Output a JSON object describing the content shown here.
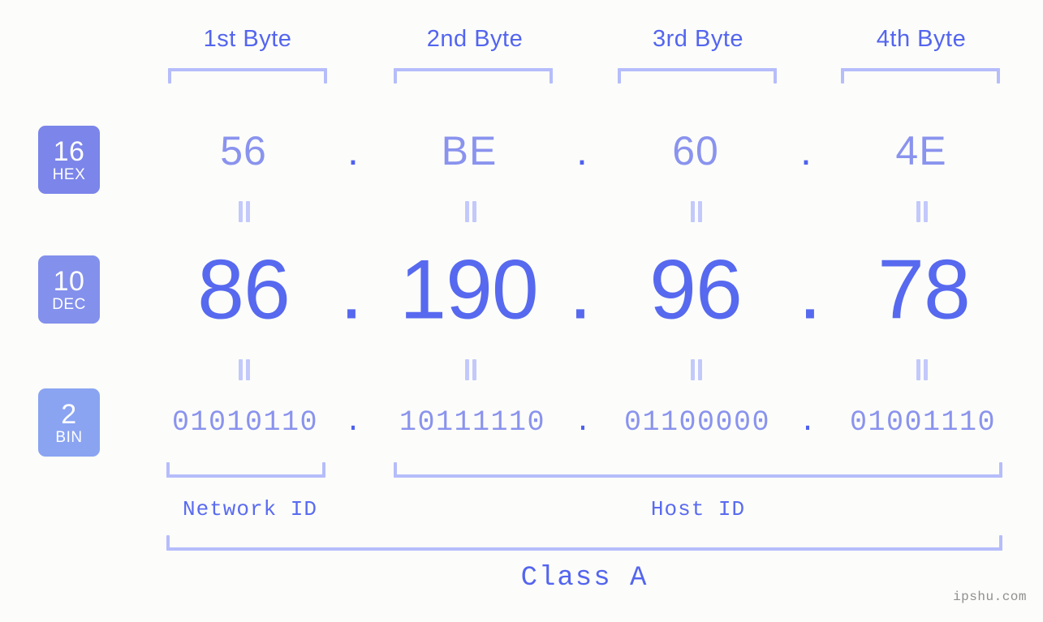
{
  "meta": {
    "watermark": "ipshu.com",
    "background_color": "#fcfdfa",
    "accent_color": "#5769ef",
    "light_accent_color": "#8a93ee",
    "bracket_color": "#b6bdfb"
  },
  "byte_headers": [
    {
      "label": "1st Byte"
    },
    {
      "label": "2nd Byte"
    },
    {
      "label": "3rd Byte"
    },
    {
      "label": "4th Byte"
    }
  ],
  "bases": [
    {
      "num": "16",
      "abbr": "HEX",
      "color": "#7b85ea"
    },
    {
      "num": "10",
      "abbr": "DEC",
      "color": "#8390ec"
    },
    {
      "num": "2",
      "abbr": "BIN",
      "color": "#8aa4f2"
    }
  ],
  "separator": ".",
  "rows": {
    "hex": {
      "values": [
        "56",
        "BE",
        "60",
        "4E"
      ]
    },
    "dec": {
      "values": [
        "86",
        "190",
        "96",
        "78"
      ]
    },
    "bin": {
      "values": [
        "01010110",
        "10111110",
        "01100000",
        "01001110"
      ]
    }
  },
  "segments": {
    "network_id": "Network ID",
    "host_id": "Host ID"
  },
  "class": {
    "label": "Class A"
  }
}
